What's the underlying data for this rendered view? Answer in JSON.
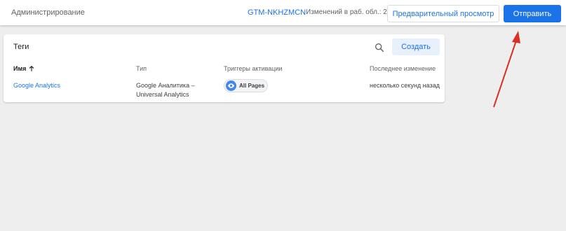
{
  "topbar": {
    "admin_label": "Администрирование",
    "container_id": "GTM-NKHZMCN",
    "changes_label": "Изменений в раб. обл.: 2",
    "preview_label": "Предварительный просмотр",
    "submit_label": "Отправить"
  },
  "tags_card": {
    "title": "Теги",
    "create_label": "Создать",
    "columns": [
      "Имя",
      "Тип",
      "Триггеры активации",
      "Последнее изменение"
    ],
    "rows": [
      {
        "name": "Google Analytics",
        "type": "Google Аналитика – Universal Analytics",
        "trigger": "All Pages",
        "edited": "несколько секунд назад"
      }
    ]
  },
  "icons": {
    "search": "search-icon",
    "sort": "arrow-up-icon",
    "trigger": "eye-icon"
  },
  "colors": {
    "accent": "#1a73e8",
    "annotation_arrow": "#d93025"
  }
}
